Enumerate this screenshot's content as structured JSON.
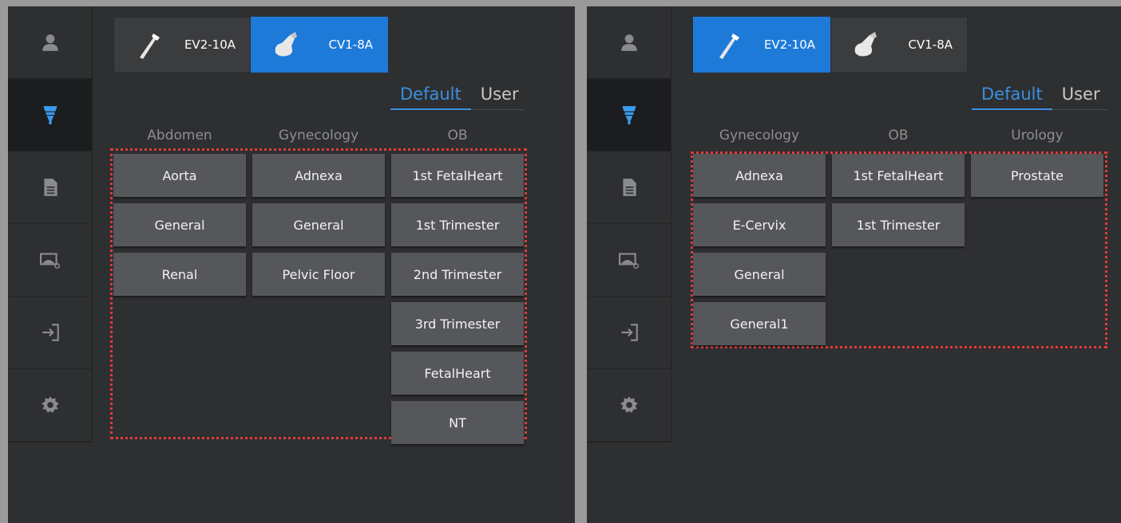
{
  "colors": {
    "accent": "#1e7ad9",
    "tab_active_text": "#3b8fe0",
    "highlight_border": "#e23a3a",
    "button_bg": "#55575a",
    "panel_bg": "#2e2f31"
  },
  "nav_icons": [
    "person-icon",
    "probe-icon",
    "document-icon",
    "image-search-icon",
    "exit-icon",
    "gear-icon"
  ],
  "left_panel": {
    "active_nav": "probe-icon",
    "probes": [
      {
        "label": "EV2-10A",
        "icon": "linear-probe-icon",
        "active": false
      },
      {
        "label": "CV1-8A",
        "icon": "convex-probe-icon",
        "active": true
      }
    ],
    "mode_tabs": [
      {
        "label": "Default",
        "active": true
      },
      {
        "label": "User",
        "active": false
      }
    ],
    "columns": [
      {
        "header": "Abdomen",
        "presets": [
          "Aorta",
          "General",
          "Renal"
        ]
      },
      {
        "header": "Gynecology",
        "presets": [
          "Adnexa",
          "General",
          "Pelvic Floor"
        ]
      },
      {
        "header": "OB",
        "presets": [
          "1st FetalHeart",
          "1st Trimester",
          "2nd Trimester",
          "3rd Trimester",
          "FetalHeart",
          "NT"
        ]
      }
    ]
  },
  "right_panel": {
    "active_nav": "probe-icon",
    "probes": [
      {
        "label": "EV2-10A",
        "icon": "linear-probe-icon",
        "active": true
      },
      {
        "label": "CV1-8A",
        "icon": "convex-probe-icon",
        "active": false
      }
    ],
    "mode_tabs": [
      {
        "label": "Default",
        "active": true
      },
      {
        "label": "User",
        "active": false
      }
    ],
    "columns": [
      {
        "header": "Gynecology",
        "presets": [
          "Adnexa",
          "E-Cervix",
          "General",
          "General1"
        ]
      },
      {
        "header": "OB",
        "presets": [
          "1st FetalHeart",
          "1st Trimester"
        ]
      },
      {
        "header": "Urology",
        "presets": [
          "Prostate"
        ]
      }
    ]
  }
}
